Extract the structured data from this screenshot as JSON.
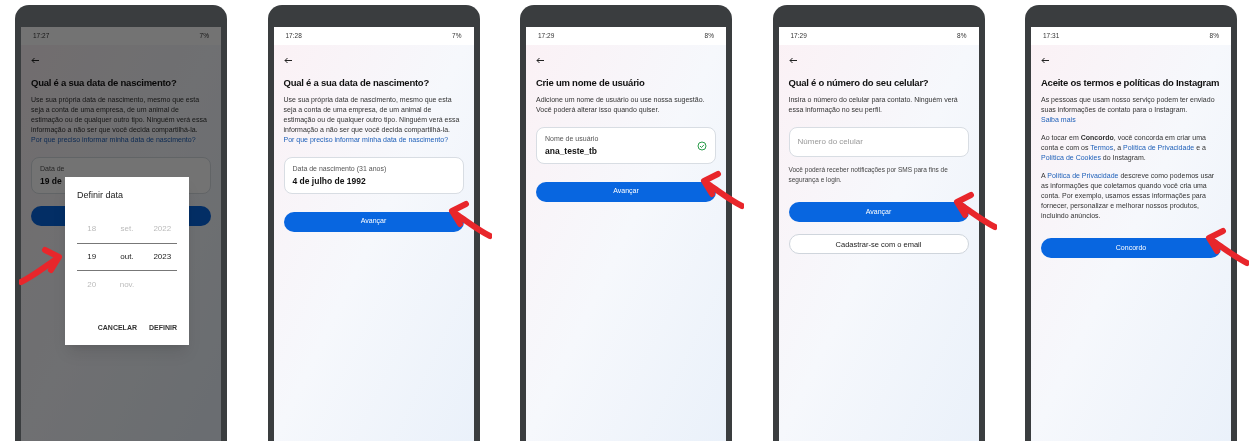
{
  "phones": [
    {
      "dimmed": true,
      "status": {
        "time": "17:27",
        "battery": "7%"
      },
      "title": "Qual é a sua data de nascimento?",
      "paragraphs": [
        [
          {
            "kind": "text",
            "text": "Use sua própria data de nascimento, mesmo que esta seja a conta de uma empresa, de um animal de estimação ou de qualquer outro tipo. Ninguém verá essa informação a não ser que você decida compartilhá-la. "
          },
          {
            "kind": "link",
            "text": "Por que preciso informar minha data de nascimento?"
          }
        ]
      ],
      "field": {
        "label": "Data de",
        "value": "19 de",
        "valid": false
      },
      "buttons": [
        {
          "kind": "primary"
        }
      ],
      "dialog": {
        "title": "Definir data",
        "rows": [
          {
            "day": "18",
            "month": "set.",
            "year": "2022",
            "selected": false
          },
          {
            "day": "19",
            "month": "out.",
            "year": "2023",
            "selected": true
          },
          {
            "day": "20",
            "month": "nov.",
            "year": "",
            "selected": false
          }
        ],
        "actions": [
          "CANCELAR",
          "DEFINIR"
        ]
      }
    },
    {
      "dimmed": false,
      "status": {
        "time": "17:28",
        "battery": "7%"
      },
      "title": "Qual é a sua data de nascimento?",
      "paragraphs": [
        [
          {
            "kind": "text",
            "text": "Use sua própria data de nascimento, mesmo que esta seja a conta de uma empresa, de um animal de estimação ou de qualquer outro tipo. Ninguém verá essa informação a não ser que você decida compartilhá-la. "
          },
          {
            "kind": "link",
            "text": "Por que preciso informar minha data de nascimento?"
          }
        ]
      ],
      "field": {
        "label": "Data de nascimento (31 anos)",
        "value": "4 de julho de 1992",
        "valid": false
      },
      "buttons": [
        {
          "kind": "primary",
          "label": "Avançar"
        }
      ]
    },
    {
      "dimmed": false,
      "status": {
        "time": "17:29",
        "battery": "8%"
      },
      "title": "Crie um nome de usuário",
      "paragraphs": [
        [
          {
            "kind": "text",
            "text": "Adicione um nome de usuário ou use nossa sugestão. Você poderá alterar isso quando quiser."
          }
        ]
      ],
      "field": {
        "label": "Nome de usuário",
        "value": "ana_teste_tb",
        "valid": true
      },
      "buttons": [
        {
          "kind": "primary",
          "label": "Avançar"
        }
      ]
    },
    {
      "dimmed": false,
      "status": {
        "time": "17:29",
        "battery": "8%"
      },
      "title": "Qual é o número do seu celular?",
      "paragraphs": [
        [
          {
            "kind": "text",
            "text": "Insira o número do celular para contato. Ninguém verá essa informação no seu perfil."
          }
        ]
      ],
      "field": {
        "placeholder": "Número do celular",
        "valid": false
      },
      "note": "Você poderá receber notificações por SMS para fins de segurança e login.",
      "buttons": [
        {
          "kind": "primary",
          "label": "Avançar"
        },
        {
          "kind": "outline",
          "label": "Cadastrar-se com o email"
        }
      ]
    },
    {
      "dimmed": false,
      "status": {
        "time": "17:31",
        "battery": "8%"
      },
      "title": "Aceite os termos e políticas do Instagram",
      "paragraphs": [
        [
          {
            "kind": "text",
            "text": "As pessoas que usam nosso serviço podem ter enviado suas informações de contato para o Instagram. "
          },
          {
            "kind": "link",
            "text": "Saiba mais"
          }
        ],
        [
          {
            "kind": "text",
            "text": "Ao tocar em **Concordo**, você concorda em criar uma conta e com os "
          },
          {
            "kind": "link",
            "text": "Termos"
          },
          {
            "kind": "text",
            "text": ", a "
          },
          {
            "kind": "link",
            "text": "Política de Privacidade"
          },
          {
            "kind": "text",
            "text": " e a "
          },
          {
            "kind": "link",
            "text": "Política de Cookies"
          },
          {
            "kind": "text",
            "text": " do Instagram."
          }
        ],
        [
          {
            "kind": "text",
            "text": "A "
          },
          {
            "kind": "link",
            "text": "Política de Privacidade"
          },
          {
            "kind": "text",
            "text": " descreve como podemos usar as informações que coletamos quando você cria uma conta. Por exemplo, usamos essas informações para fornecer, personalizar e melhorar nossos produtos, incluindo anúncios."
          }
        ]
      ],
      "buttons": [
        {
          "kind": "primary",
          "label": "Concordo"
        }
      ]
    }
  ]
}
